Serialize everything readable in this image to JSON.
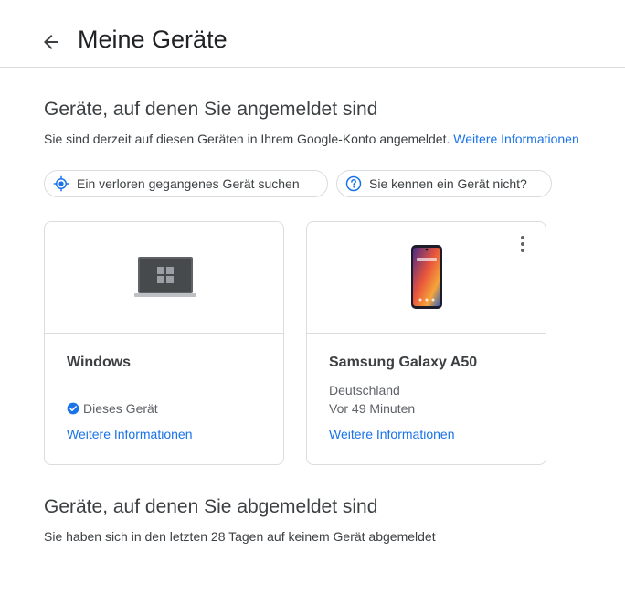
{
  "header": {
    "title": "Meine Geräte",
    "back_icon": "arrow-back-icon"
  },
  "signed_in": {
    "title": "Geräte, auf denen Sie angemeldet sind",
    "description": "Sie sind derzeit auf diesen Geräten in Ihrem Google-Konto angemeldet.",
    "more_info_link": "Weitere Informationen"
  },
  "actions": {
    "find_device_label": "Ein verloren gegangenes Gerät suchen",
    "find_device_icon": "locate-icon",
    "unknown_device_label": "Sie kennen ein Gerät nicht?",
    "unknown_device_icon": "help-circle-icon"
  },
  "devices": [
    {
      "name": "Windows",
      "status": "Dieses Gerät",
      "status_icon": "verified-check-icon",
      "link": "Weitere Informationen",
      "image": "windows-laptop-image"
    },
    {
      "name": "Samsung Galaxy A50",
      "location": "Deutschland",
      "last_active": "Vor 49 Minuten",
      "link": "Weitere Informationen",
      "image": "samsung-phone-image",
      "menu_icon": "more-vert-icon"
    }
  ],
  "signed_out": {
    "title": "Geräte, auf denen Sie abgemeldet sind",
    "description": "Sie haben sich in den letzten 28 Tagen auf keinem Gerät abgemeldet"
  },
  "colors": {
    "link": "#1a73e8",
    "text": "#202124",
    "border": "#dadce0",
    "icon_blue": "#1a73e8"
  }
}
